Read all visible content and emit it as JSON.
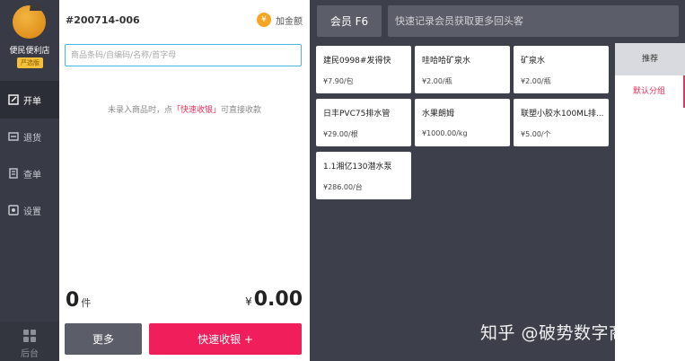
{
  "nav": {
    "store_name": "便民便利店",
    "store_badge": "严选版",
    "items": [
      {
        "label": "开单",
        "icon": "edit-icon"
      },
      {
        "label": "退货",
        "icon": "return-icon"
      },
      {
        "label": "查单",
        "icon": "document-icon"
      },
      {
        "label": "设置",
        "icon": "gear-icon"
      }
    ],
    "bottom_label": "后台"
  },
  "order": {
    "number": "#200714-006",
    "add_amount_label": "加金额",
    "add_amount_icon": "¥",
    "search_placeholder": "商品条码/自编码/名称/首字母",
    "hint_before": "未录入商品时，点",
    "hint_highlight": "「快速收银」",
    "hint_after": "可直接收款",
    "quantity": "0",
    "quantity_unit": "件",
    "currency": "¥",
    "total": "0.00",
    "more_label": "更多",
    "checkout_label": "快速收银 +"
  },
  "member": {
    "button_label": "会员 F6",
    "input_placeholder": "快速记录会员获取更多回头客"
  },
  "products": [
    {
      "name": "建民0998#发得快",
      "price": "¥7.90/包"
    },
    {
      "name": "哇哈哈矿泉水",
      "price": "¥2.00/瓶"
    },
    {
      "name": "矿泉水",
      "price": "¥2.00/瓶"
    },
    {
      "name": "日丰PVC75排水管",
      "price": "¥29.00/根"
    },
    {
      "name": "水果朗姆",
      "price": "¥1000.00/kg"
    },
    {
      "name": "联塑小胶水100ML排...",
      "price": "¥5.00/个"
    },
    {
      "name": "1.1湘亿130潜水泵",
      "price": "¥286.00/台"
    }
  ],
  "categories": {
    "recommend": "推荐",
    "default": "默认分组"
  },
  "watermark": "知乎 @破势数字商业",
  "colors": {
    "accent": "#f01f5c",
    "input_border": "#4fb4df",
    "sidebar": "#383a46",
    "right_bg": "#3d3f4b",
    "button_gray": "#5b5d68"
  }
}
